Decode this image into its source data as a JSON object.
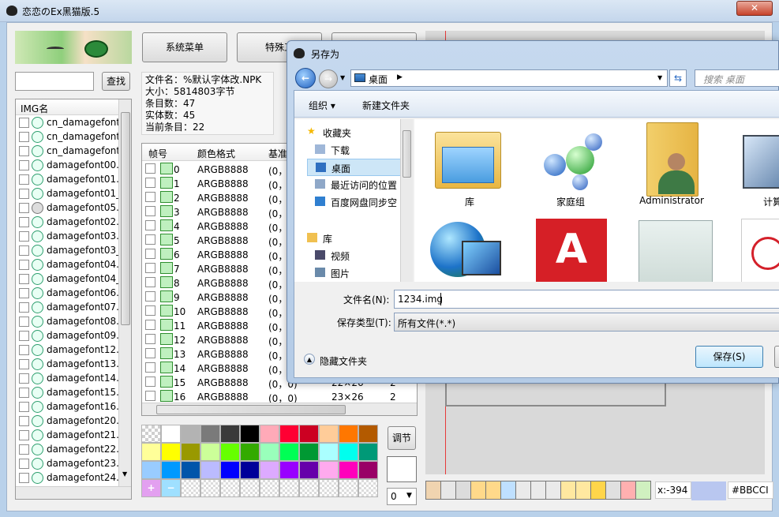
{
  "main": {
    "title": "恋恋のEx黑猫版.5",
    "search_button": "查找",
    "search_value": "",
    "menu_buttons": [
      "系统菜单",
      "特殊工",
      ""
    ],
    "file_info": {
      "filename": "文件名：%默认字体改.NPK",
      "size": "大小：5814803字节",
      "entries": "条目数：47",
      "real": "实体数：45",
      "current": "当前条目：22"
    },
    "img_list": {
      "header": "IMG名",
      "items": [
        "cn_damagefont0",
        "cn_damagefont0",
        "cn_damagefont0",
        "damagefont00.im",
        "damagefont01.im",
        "damagefont01_b",
        "damagefont05.im",
        "damagefont02.im",
        "damagefont03.im",
        "damagefont03_v",
        "damagefont04.im",
        "damagefont04_r",
        "damagefont06.im",
        "damagefont07.im",
        "damagefont08.im",
        "damagefont09.im",
        "damagefont12.im",
        "damagefont13.im",
        "damagefont14.im",
        "damagefont15.im",
        "damagefont16.im",
        "damagefont20.im",
        "damagefont21.im",
        "damagefont22.im",
        "damagefont23.im",
        "damagefont24.im"
      ]
    },
    "frame_table": {
      "headers": [
        "帧号",
        "颜色格式",
        "基准"
      ],
      "rows": [
        [
          "0",
          "ARGB8888",
          "(0，"
        ],
        [
          "1",
          "ARGB8888",
          "(0，"
        ],
        [
          "2",
          "ARGB8888",
          "(0，"
        ],
        [
          "3",
          "ARGB8888",
          "(0，"
        ],
        [
          "4",
          "ARGB8888",
          "(0，"
        ],
        [
          "5",
          "ARGB8888",
          "(0，"
        ],
        [
          "6",
          "ARGB8888",
          "(0，"
        ],
        [
          "7",
          "ARGB8888",
          "(0，"
        ],
        [
          "8",
          "ARGB8888",
          "(0，"
        ],
        [
          "9",
          "ARGB8888",
          "(0，"
        ],
        [
          "10",
          "ARGB8888",
          "(0，"
        ],
        [
          "11",
          "ARGB8888",
          "(0，"
        ],
        [
          "12",
          "ARGB8888",
          "(0，"
        ],
        [
          "13",
          "ARGB8888",
          "(0，"
        ],
        [
          "14",
          "ARGB8888",
          "(0，"
        ],
        [
          "15",
          "ARGB8888",
          "(0，0)",
          "22×26",
          "2"
        ],
        [
          "16",
          "ARGB8888",
          "(0，0)",
          "23×26",
          "2"
        ]
      ]
    },
    "adjust_button": "调节",
    "dropdown_value": "0",
    "coord": "x:-394",
    "color_hex": "#BBCCI",
    "palette": [
      "#ffffff",
      "#b3b3b3",
      "#7a7a7a",
      "#3a3a3a",
      "#000000",
      "#ffaab8",
      "#ff0033",
      "#cc0022",
      "#ffcc99",
      "#ff7700",
      "#b35a00",
      "#ffff99",
      "#ffff00",
      "#999900",
      "#ccff99",
      "#66ff00",
      "#33aa00",
      "#99ffbb",
      "#00ff55",
      "#009933",
      "#aaffff",
      "#00ffee",
      "#009977",
      "#99ccff",
      "#0099ff",
      "#0055aa",
      "#bbbbff",
      "#0000ff",
      "#000099",
      "#ddaaff",
      "#9900ff",
      "#6600aa",
      "#ffaaee",
      "#ff00bb",
      "#990066"
    ]
  },
  "dialog": {
    "title": "另存为",
    "address": "桌面",
    "search_placeholder": "搜索 桌面",
    "organize": "组织 ▾",
    "new_folder": "新建文件夹",
    "nav": [
      "收藏夹",
      "下载",
      "桌面",
      "最近访问的位置",
      "百度网盘同步空",
      "库",
      "视频",
      "图片"
    ],
    "icons": [
      "库",
      "家庭组",
      "Administrator",
      "计算"
    ],
    "filename_label": "文件名(N):",
    "filename_value": "1234.img",
    "filetype_label": "保存类型(T):",
    "filetype_value": "所有文件(*.*)",
    "hide_folders": "隐藏文件夹",
    "save": "保存(S)"
  }
}
